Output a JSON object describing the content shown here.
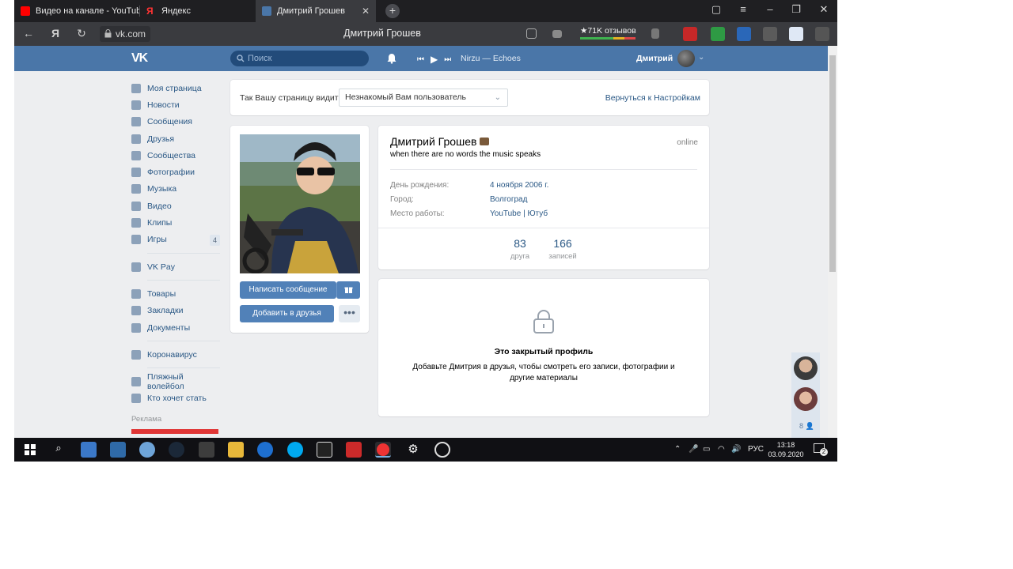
{
  "browser": {
    "tabs": [
      {
        "label": "Видео на канале - YouTube",
        "active": false
      },
      {
        "label": "Яндекс",
        "active": false
      },
      {
        "label": "Дмитрий Грошев",
        "active": true
      }
    ],
    "url": "vk.com",
    "page_title": "Дмитрий Грошев",
    "reviews": "★71K отзывов"
  },
  "vk_header": {
    "logo": "VK",
    "search_placeholder": "Поиск",
    "track": "Nirzu — Echoes",
    "user": "Дмитрий"
  },
  "menu": {
    "items": [
      {
        "label": "Моя страница",
        "icon": "home-icon"
      },
      {
        "label": "Новости",
        "icon": "news-icon"
      },
      {
        "label": "Сообщения",
        "icon": "messages-icon"
      },
      {
        "label": "Друзья",
        "icon": "friends-icon"
      },
      {
        "label": "Сообщества",
        "icon": "groups-icon"
      },
      {
        "label": "Фотографии",
        "icon": "camera-icon"
      },
      {
        "label": "Музыка",
        "icon": "music-icon"
      },
      {
        "label": "Видео",
        "icon": "video-icon"
      },
      {
        "label": "Клипы",
        "icon": "clips-icon"
      },
      {
        "label": "Игры",
        "icon": "games-icon",
        "badge": "4"
      }
    ],
    "pay": {
      "label": "VK Pay",
      "icon": "vkpay-icon"
    },
    "items2": [
      {
        "label": "Товары",
        "icon": "bag-icon"
      },
      {
        "label": "Закладки",
        "icon": "star-icon"
      },
      {
        "label": "Документы",
        "icon": "document-icon"
      }
    ],
    "corona": {
      "label": "Коронавирус",
      "icon": "virus-icon"
    },
    "apps": [
      {
        "label": "Пляжный волейбол",
        "icon": "apps-icon"
      },
      {
        "label": "Кто хочет стать",
        "icon": "apps-icon"
      }
    ],
    "ads": "Реклама"
  },
  "view_as": {
    "label": "Так Вашу страницу видит",
    "selected": "Незнакомый Вам пользователь",
    "back": "Вернуться к Настройкам"
  },
  "profile": {
    "name": "Дмитрий Грошев",
    "status": "when there are no words the music speaks",
    "online": "online",
    "fields": [
      {
        "label": "День рождения:",
        "value": "4 ноября 2006 г."
      },
      {
        "label": "Город:",
        "value": "Волгоград"
      },
      {
        "label": "Место работы:",
        "value": "YouTube | Ютуб"
      }
    ],
    "counters": [
      {
        "num": "83",
        "cap": "друга"
      },
      {
        "num": "166",
        "cap": "записей"
      }
    ],
    "message_btn": "Написать сообщение",
    "add_friend_btn": "Добавить в друзья"
  },
  "closed": {
    "title": "Это закрытый профиль",
    "desc": "Добавьте Дмитрия в друзья, чтобы смотреть его записи, фотографии и другие материалы"
  },
  "chat": {
    "count": "8"
  },
  "taskbar": {
    "lang": "РУС",
    "time": "13:18",
    "date": "03.09.2020",
    "notifications": "2"
  },
  "colors": {
    "vk_blue": "#4a76a8",
    "link": "#2a5885",
    "button": "#5181b8"
  }
}
